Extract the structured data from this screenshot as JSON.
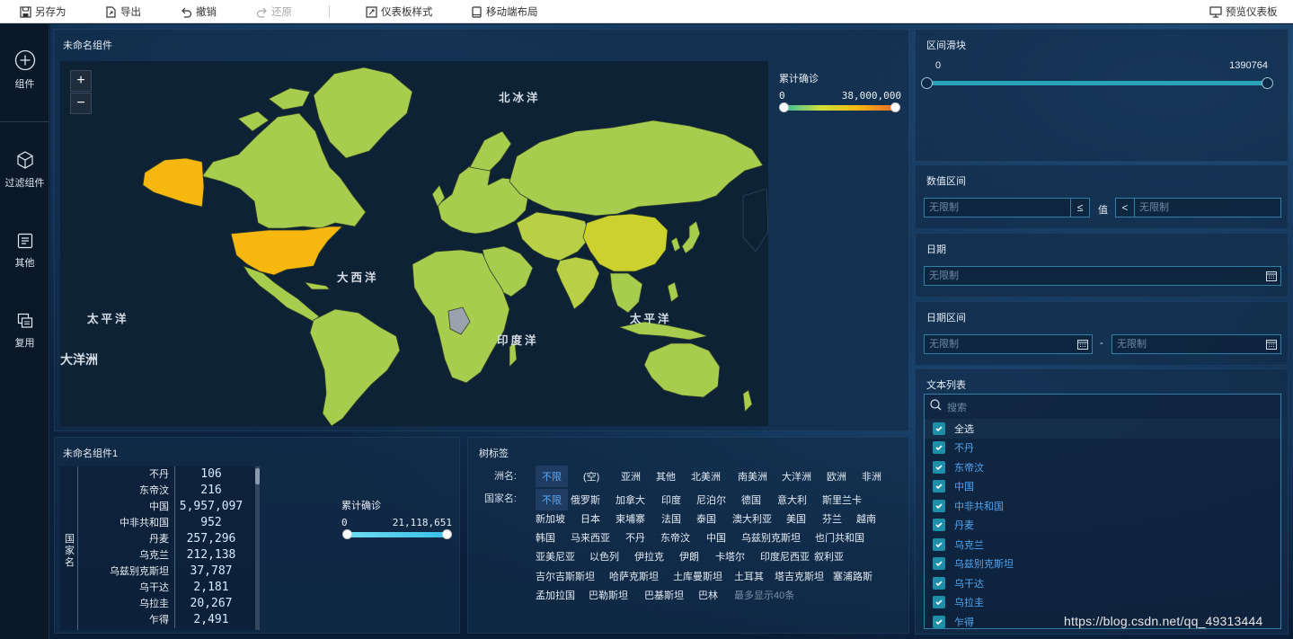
{
  "toolbar": {
    "save_as": "另存为",
    "export": "导出",
    "undo": "撤销",
    "redo": "还原",
    "dashboard_style": "仪表板样式",
    "mobile_layout": "移动端布局",
    "preview": "预览仪表板"
  },
  "sidebar": {
    "items": [
      {
        "label": "组件",
        "icon": "plus-circle-icon"
      },
      {
        "label": "过滤组件",
        "icon": "cube-icon"
      },
      {
        "label": "其他",
        "icon": "document-icon"
      },
      {
        "label": "复用",
        "icon": "copy-icon"
      }
    ]
  },
  "map_panel": {
    "title": "未命名组件",
    "zoom_in": "+",
    "zoom_out": "−",
    "ocean_labels": {
      "arctic": "北冰洋",
      "atlantic": "大西洋",
      "indian": "印度洋",
      "pacific_west": "太平洋",
      "pacific_east": "太平洋",
      "oceania": "大洋洲"
    },
    "legend": {
      "title": "累计确诊",
      "min": "0",
      "max": "38,000,000"
    }
  },
  "table_panel": {
    "title": "未命名组件1",
    "row_header": "国家名",
    "rows": [
      {
        "country": "不丹",
        "value": "106"
      },
      {
        "country": "东帝汶",
        "value": "216"
      },
      {
        "country": "中国",
        "value": "5,957,097"
      },
      {
        "country": "中非共和国",
        "value": "952"
      },
      {
        "country": "丹麦",
        "value": "257,296"
      },
      {
        "country": "乌克兰",
        "value": "212,138"
      },
      {
        "country": "乌兹别克斯坦",
        "value": "37,787"
      },
      {
        "country": "乌干达",
        "value": "2,181"
      },
      {
        "country": "乌拉圭",
        "value": "20,267"
      },
      {
        "country": "乍得",
        "value": "2,491"
      }
    ],
    "legend": {
      "title": "累计确诊",
      "min": "0",
      "max": "21,118,651"
    }
  },
  "tree_panel": {
    "title": "树标签",
    "continent_label": "洲名:",
    "country_label": "国家名:",
    "continents": [
      "不限",
      "(空)",
      "亚洲",
      "其他",
      "北美洲",
      "南美洲",
      "大洋洲",
      "欧洲",
      "非洲"
    ],
    "country_rows": [
      [
        "不限",
        "俄罗斯",
        "加拿大",
        "印度",
        "尼泊尔",
        "德国",
        "意大利",
        "斯里兰卡"
      ],
      [
        "新加坡",
        "日本",
        "柬埔寨",
        "法国",
        "泰国",
        "澳大利亚",
        "美国",
        "芬兰",
        "越南"
      ],
      [
        "韩国",
        "马来西亚",
        "不丹",
        "东帝汶",
        "中国",
        "乌兹别克斯坦",
        "也门共和国"
      ],
      [
        "亚美尼亚",
        "以色列",
        "伊拉克",
        "伊朗",
        "卡塔尔",
        "印度尼西亚",
        "叙利亚"
      ],
      [
        "吉尔吉斯斯坦",
        "哈萨克斯坦",
        "土库曼斯坦",
        "土耳其",
        "塔吉克斯坦",
        "塞浦路斯"
      ],
      [
        "孟加拉国",
        "巴勒斯坦",
        "巴基斯坦",
        "巴林",
        "最多显示40条"
      ]
    ]
  },
  "range_slider": {
    "title": "区间滑块",
    "min": "0",
    "max": "1390764"
  },
  "number_range": {
    "title": "数值区间",
    "left_placeholder": "无限制",
    "left_op": "≤",
    "value_label": "值",
    "right_op": "<",
    "right_placeholder": "无限制"
  },
  "date": {
    "title": "日期",
    "placeholder": "无限制"
  },
  "date_range": {
    "title": "日期区间",
    "start_placeholder": "无限制",
    "separator": "-",
    "end_placeholder": "无限制"
  },
  "text_list": {
    "title": "文本列表",
    "search_placeholder": "搜索",
    "select_all": "全选",
    "items": [
      "不丹",
      "东帝汶",
      "中国",
      "中非共和国",
      "丹麦",
      "乌克兰",
      "乌兹别克斯坦",
      "乌干达",
      "乌拉圭",
      "乍得"
    ]
  },
  "watermark": "https://blog.csdn.net/qq_49313444",
  "colors": {
    "accent": "#2aa3b8",
    "selected_text": "#4ea6f2",
    "map_land": "#a8cc4e",
    "map_high": "#f6b70f",
    "map_nodata": "#9aa3ad"
  }
}
